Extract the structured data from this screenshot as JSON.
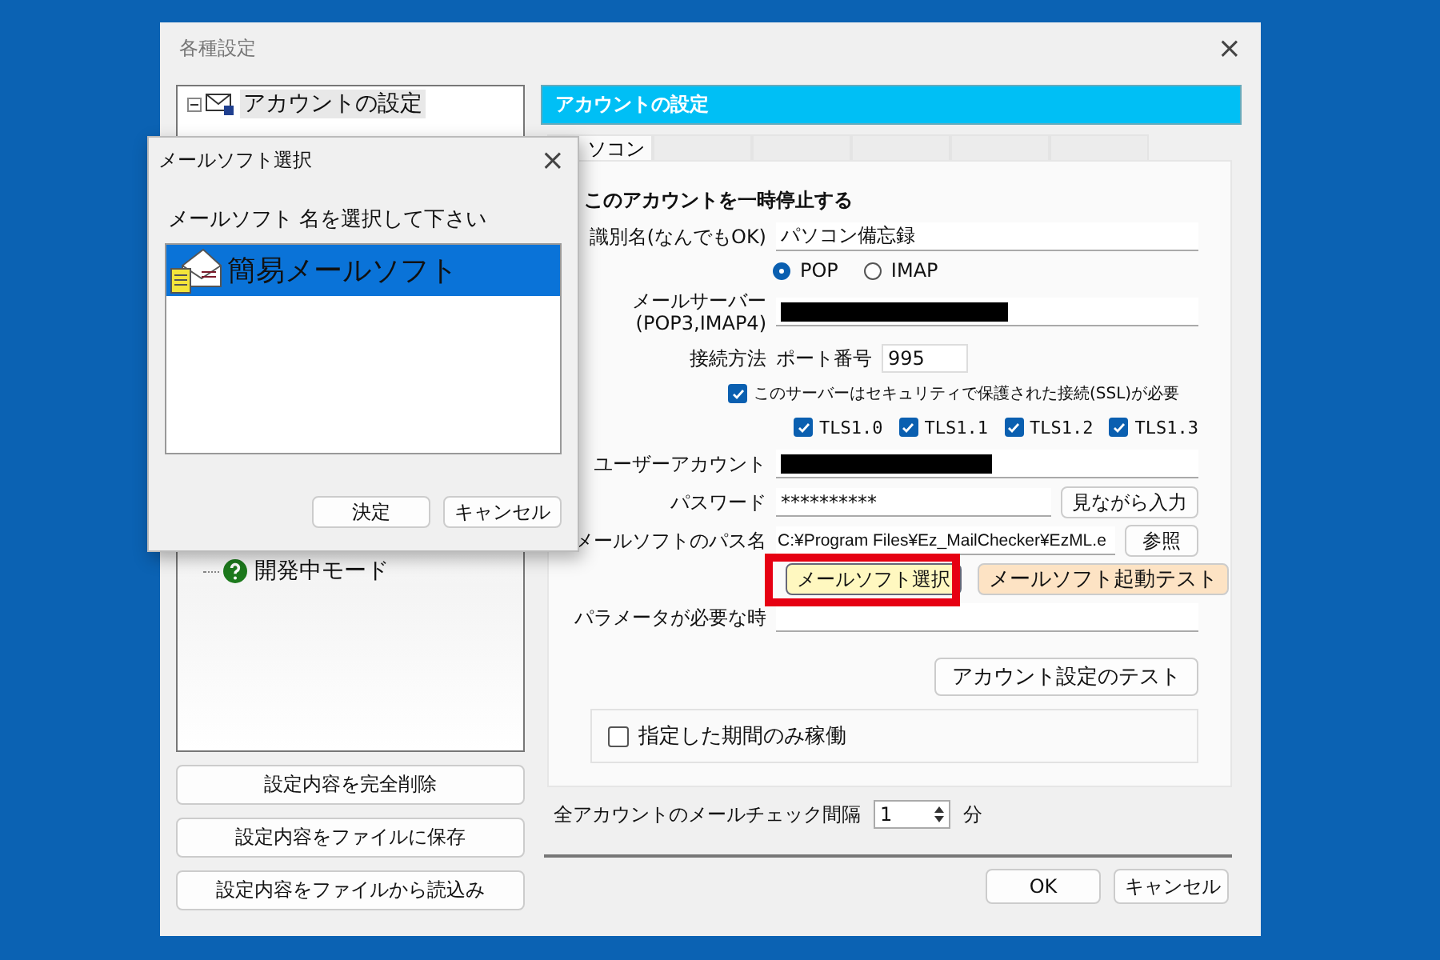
{
  "window": {
    "title": "各種設定",
    "close": "×"
  },
  "tree": {
    "items": [
      {
        "label": "アカウントの設定",
        "selected": true,
        "expanded": true,
        "children": [
          {
            "label": "開発中モード",
            "selected": false
          }
        ]
      }
    ]
  },
  "left_buttons": [
    "設定内容を完全削除",
    "設定内容をファイルに保存",
    "設定内容をファイルから読込み"
  ],
  "header": "アカウントの設定",
  "tabs": [
    {
      "label": "ソコン",
      "selected": true
    }
  ],
  "form": {
    "pause_label": "このアカウントを一時停止する",
    "name": {
      "label": "識別名(なんでもOK)",
      "value": "パソコン備忘録"
    },
    "protocol": {
      "options": [
        {
          "label": "POP",
          "selected": true
        },
        {
          "label": "IMAP",
          "selected": false
        }
      ]
    },
    "server": {
      "label": [
        "メールサーバー",
        "(POP3,IMAP4)"
      ],
      "redacted": true
    },
    "connection": {
      "label": "接続方法",
      "port_label": "ポート番号",
      "port": "995"
    },
    "ssl": {
      "label": "このサーバーはセキュリティで保護された接続(SSL)が必要",
      "checked": true
    },
    "tls": [
      {
        "label": "TLS1.0",
        "checked": true
      },
      {
        "label": "TLS1.1",
        "checked": true
      },
      {
        "label": "TLS1.2",
        "checked": true
      },
      {
        "label": "TLS1.3",
        "checked": true
      }
    ],
    "user": {
      "label": "ユーザーアカウント",
      "redacted": true
    },
    "password": {
      "label": "パスワード",
      "value": "**********",
      "button": "見ながら入力"
    },
    "path": {
      "label": "メールソフトのパス名",
      "value": "C:¥Program Files¥Ez_MailChecker¥EzML.e",
      "button": "参照"
    },
    "select_button": "メールソフト選択",
    "test_launch_button": "メールソフト起動テスト",
    "params": {
      "label": "パラメータが必要な時"
    },
    "test_button": "アカウント設定のテスト",
    "period": {
      "label": "指定した期間のみ稼働",
      "checked": false
    }
  },
  "interval": {
    "label": "全アカウントのメールチェック間隔",
    "value": "1",
    "unit": "分"
  },
  "buttons": [
    "OK",
    "キャンセル"
  ],
  "dialog": {
    "title": "メールソフト選択",
    "close": "×",
    "prompt": "メールソフト 名を選択して下さい",
    "items": [
      {
        "label": "簡易メールソフト",
        "selected": true
      }
    ],
    "buttons": [
      "決定",
      "キャンセル"
    ]
  }
}
